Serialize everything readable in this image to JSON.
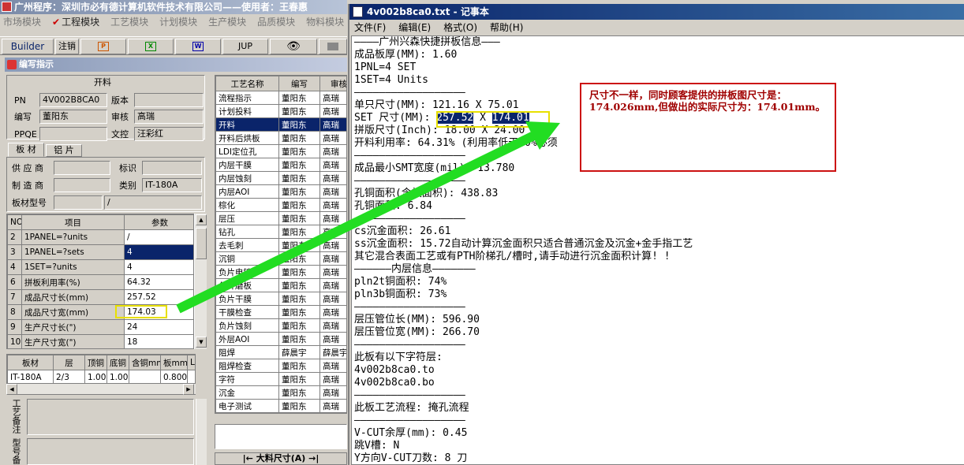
{
  "app": {
    "title": "广州程序：深圳市必有德计算机软件技术有限公司——使用者：王春惠",
    "modules": [
      "市场模块",
      "工程模块",
      "工艺模块",
      "计划模块",
      "生产模块",
      "品质模块",
      "物料模块"
    ],
    "active_module": "工程模块",
    "toolbar": [
      "Builder",
      "注销",
      "",
      "",
      "",
      "JUP",
      "",
      ""
    ],
    "panel_title": "编写指示",
    "section_title": "开料"
  },
  "form": {
    "pn_label": "PN",
    "pn_value": "4V002B8CA0",
    "version_label": "版本",
    "version_value": "",
    "writer_label": "编写",
    "writer_value": "董阳东",
    "reviewer_label": "审核",
    "reviewer_value": "高瑞",
    "ppqe_label": "PPQE",
    "ppqe_value": "",
    "clerk_label": "文控",
    "clerk_value": "汪彩红",
    "tabs": [
      "板 材",
      "铝 片"
    ],
    "supplier_label": "供 应 商",
    "supplier_value": "",
    "mark_label": "标识",
    "mark_value": "",
    "maker_label": "制 造 商",
    "maker_value": "",
    "category_label": "类别",
    "category_value": "IT-180A",
    "model_label": "板材型号",
    "model_value": "",
    "model_value2": "/"
  },
  "params": {
    "headers": [
      "NO",
      "项目",
      "参数"
    ],
    "rows": [
      [
        "2",
        "1PANEL=?units",
        "/"
      ],
      [
        "3",
        "1PANEL=?sets",
        "4"
      ],
      [
        "4",
        "1SET=?units",
        "4"
      ],
      [
        "6",
        "拼板利用率(%)",
        "64.32"
      ],
      [
        "7",
        "成品尺寸长(mm)",
        "257.52"
      ],
      [
        "8",
        "成品尺寸宽(mm)",
        "174.03"
      ],
      [
        "9",
        "生产尺寸长(\")",
        "24"
      ],
      [
        "10",
        "生产尺寸宽(\")",
        "18"
      ]
    ]
  },
  "material": {
    "headers": [
      "板材",
      "层",
      "顶铜",
      "底铜",
      "含铜mm",
      "板mm",
      "L"
    ],
    "row": [
      "IT-180A",
      "2/3",
      "1.00",
      "1.00",
      "",
      "0.800",
      ""
    ]
  },
  "remarks_label": "工艺备注",
  "remarks_label2": "型号备",
  "processes": {
    "headers": [
      "工艺名称",
      "编写",
      "审核"
    ],
    "rows": [
      [
        "流程指示",
        "董阳东",
        "高瑞"
      ],
      [
        "计划投料",
        "董阳东",
        "高瑞"
      ],
      [
        "开料",
        "董阳东",
        "高瑞"
      ],
      [
        "开料后烘板",
        "董阳东",
        "高瑞"
      ],
      [
        "LDI定位孔",
        "董阳东",
        "高瑞"
      ],
      [
        "内层干膜",
        "董阳东",
        "高瑞"
      ],
      [
        "内层蚀刻",
        "董阳东",
        "高瑞"
      ],
      [
        "内层AOI",
        "董阳东",
        "高瑞"
      ],
      [
        "棕化",
        "董阳东",
        "高瑞"
      ],
      [
        "层压",
        "董阳东",
        "高瑞"
      ],
      [
        "钻孔",
        "董阳东",
        "高瑞"
      ],
      [
        "去毛刺",
        "董阳东",
        "高瑞"
      ],
      [
        "沉铜",
        "董阳东",
        "高瑞"
      ],
      [
        "负片电镀",
        "董阳东",
        "高瑞"
      ],
      [
        "负片磨板",
        "董阳东",
        "高瑞"
      ],
      [
        "负片干膜",
        "董阳东",
        "高瑞"
      ],
      [
        "干膜检查",
        "董阳东",
        "高瑞"
      ],
      [
        "负片蚀刻",
        "董阳东",
        "高瑞"
      ],
      [
        "外层AOI",
        "董阳东",
        "高瑞"
      ],
      [
        "阻焊",
        "薛晨宇",
        "薛晨宇"
      ],
      [
        "阻焊检查",
        "董阳东",
        "高瑞"
      ],
      [
        "字符",
        "董阳东",
        "高瑞"
      ],
      [
        "沉金",
        "董阳东",
        "高瑞"
      ],
      [
        "电子测试",
        "董阳东",
        "高瑞"
      ]
    ],
    "selected_index": 2
  },
  "bottom_bar_label": "|←  大料尺寸(A) →|",
  "notepad": {
    "title": "4v002b8ca0.txt - 记事本",
    "menu": [
      "文件(F)",
      "编辑(E)",
      "格式(O)",
      "帮助(H)"
    ],
    "lines": [
      "————广州兴森快捷拼板信息———",
      "成品板厚(MM): 1.60",
      "1PNL=4 SET",
      "1SET=4 Units",
      "——————————————————",
      "单只尺寸(MM): 121.16 X 75.01",
      "SET 尺寸(MM): 257.52 X 174.01",
      "拼版尺寸(Inch): 18.00 X 24.00",
      "开料利用率: 64.31% (利用率低于70%必须",
      "——————————————————",
      "成品最小SMT宽度(mil): 13.780",
      "——————————————————",
      "孔铜面积(含板面积): 438.83",
      "孔铜面积: 6.84",
      "——————————————————",
      "cs沉金面积: 26.61",
      "ss沉金面积: 15.72自动计算沉金面积只适合普通沉金及沉金+金手指工艺",
      "其它混合表面工艺或有PTH阶梯孔/槽时,请手动进行沉金面积计算! !",
      "——————内层信息———————",
      "pln2t铜面积: 74%",
      "pln3b铜面积: 73%",
      "——————————————————",
      "层压管位长(MM): 596.90",
      "层压管位宽(MM): 266.70",
      "——————————————————",
      "此板有以下字符层:",
      "4v002b8ca0.to",
      "4v002b8ca0.bo",
      "——————————————————",
      "此板工艺流程: 掩孔流程",
      "——————————————————",
      "V-CUT余厚(mm): 0.45",
      "跳V槽: N",
      "Y方向V-CUT刀数: 8 刀"
    ],
    "set_prefix": "SET 尺寸(MM): ",
    "set_len": "257.52",
    "set_x": " X ",
    "set_wid": "174.01"
  },
  "annotation": {
    "text": "尺寸不一样，同时顾客提供的拼板图尺寸是：174.026mm,但做出的实际尺寸为：174.01mm。",
    "colors": {
      "box": "#cc1111",
      "arrow": "#22dd22",
      "highlight": "#e8e000"
    }
  }
}
